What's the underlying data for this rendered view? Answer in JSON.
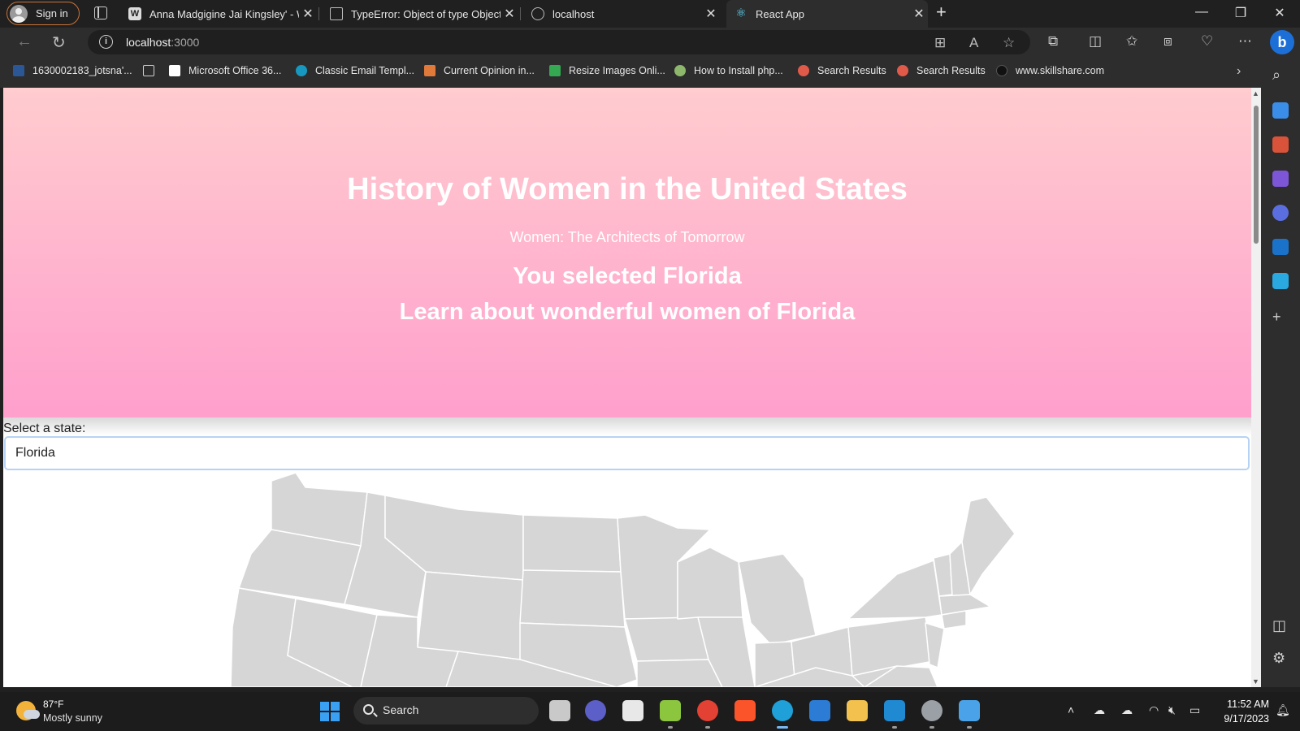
{
  "browser": {
    "signin_label": "Sign in",
    "tabs": [
      {
        "title": "Anna Madgigine Jai Kingsley' - W",
        "favicon": "wikipedia-icon"
      },
      {
        "title": "TypeError: Object of type Object",
        "favicon": "page-icon"
      },
      {
        "title": "localhost",
        "favicon": "localhost-icon"
      },
      {
        "title": "React App",
        "favicon": "react-icon",
        "active": true
      }
    ],
    "address": {
      "host": "localhost",
      "port": ":3000"
    },
    "favorites": [
      {
        "label": "1630002183_jotsna'...",
        "icon": "word-icon",
        "color": "#2b5797"
      },
      {
        "label": "",
        "icon": "document-icon",
        "color": "#cfcfcf"
      },
      {
        "label": "Microsoft Office 36...",
        "icon": "page-icon",
        "color": "#ffffff"
      },
      {
        "label": "Classic Email Templ...",
        "icon": "salesforce-icon",
        "color": "#1798c1"
      },
      {
        "label": "Current Opinion in...",
        "icon": "journal-icon",
        "color": "#e07a3a"
      },
      {
        "label": "Resize Images Onli...",
        "icon": "resize-icon",
        "color": "#35a852"
      },
      {
        "label": "How to Install php...",
        "icon": "php-icon",
        "color": "#8db86b"
      },
      {
        "label": "Search Results",
        "icon": "search-results-icon",
        "color": "#e05a4a"
      },
      {
        "label": "Search Results",
        "icon": "search-results-icon",
        "color": "#e05a4a"
      },
      {
        "label": "www.skillshare.com",
        "icon": "skillshare-icon",
        "color": "#111111"
      }
    ]
  },
  "page": {
    "title": "History of Women in the United States",
    "tagline": "Women: The Architects of Tomorrow",
    "selected_text": "You selected Florida",
    "learn_text": "Learn about wonderful women of Florida",
    "select_label": "Select a state:",
    "select_value": "Florida"
  },
  "taskbar": {
    "weather_temp": "87°F",
    "weather_desc": "Mostly sunny",
    "search_label": "Search",
    "time": "11:52 AM",
    "date": "9/17/2023"
  },
  "colors": {
    "hero_top": "#ffcccf",
    "hero_bottom": "#ff9fcc",
    "map_fill": "#d6d6d6",
    "map_stroke": "#ffffff"
  }
}
